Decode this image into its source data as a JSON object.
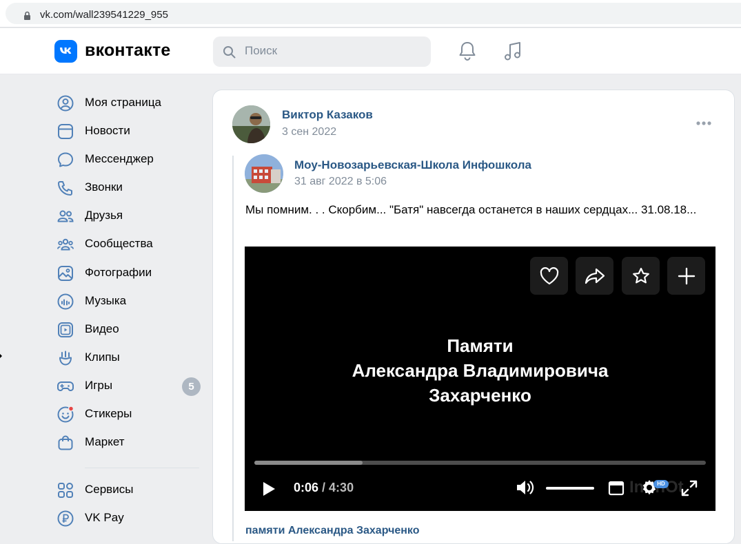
{
  "browser": {
    "url": "vk.com/wall239541229_955"
  },
  "header": {
    "logo_text": "вконтакте",
    "search_placeholder": "Поиск"
  },
  "sidebar": {
    "items": [
      {
        "label": "Моя страница",
        "icon": "user-circle-icon"
      },
      {
        "label": "Новости",
        "icon": "newsfeed-icon"
      },
      {
        "label": "Мессенджер",
        "icon": "message-icon"
      },
      {
        "label": "Звонки",
        "icon": "phone-icon"
      },
      {
        "label": "Друзья",
        "icon": "friends-icon"
      },
      {
        "label": "Сообщества",
        "icon": "communities-icon"
      },
      {
        "label": "Фотографии",
        "icon": "photos-icon"
      },
      {
        "label": "Музыка",
        "icon": "music-icon"
      },
      {
        "label": "Видео",
        "icon": "video-icon"
      },
      {
        "label": "Клипы",
        "icon": "clips-icon"
      },
      {
        "label": "Игры",
        "icon": "games-icon",
        "badge": "5"
      },
      {
        "label": "Стикеры",
        "icon": "stickers-icon"
      },
      {
        "label": "Маркет",
        "icon": "market-icon"
      },
      {
        "label": "Сервисы",
        "icon": "services-icon"
      },
      {
        "label": "VK Pay",
        "icon": "vkpay-icon"
      }
    ]
  },
  "post": {
    "author": "Виктор Казаков",
    "date": "3 сен 2022",
    "repost": {
      "author": "Моу-Новозарьевская-Школа Инфошкола",
      "date": "31 авг 2022 в 5:06",
      "text": "Мы помним. . . Скорбим... \"Батя\" навсегда останется в наших сердцах... 31.08.18..."
    },
    "video": {
      "title_line1": "Памяти",
      "title_line2": "Александра Владимировича",
      "title_line3": "Захарченко",
      "current_time": "0:06",
      "duration": "4:30",
      "progress_fraction": 0.024,
      "buffered_fraction": 0.24,
      "hd_badge": "HD",
      "watermark": "InShOt",
      "caption": "памяти Александра Захарченко"
    }
  },
  "colors": {
    "accent": "#0077ff",
    "link": "#2a5885",
    "muted": "#818c99",
    "icon": "#5181b8"
  }
}
